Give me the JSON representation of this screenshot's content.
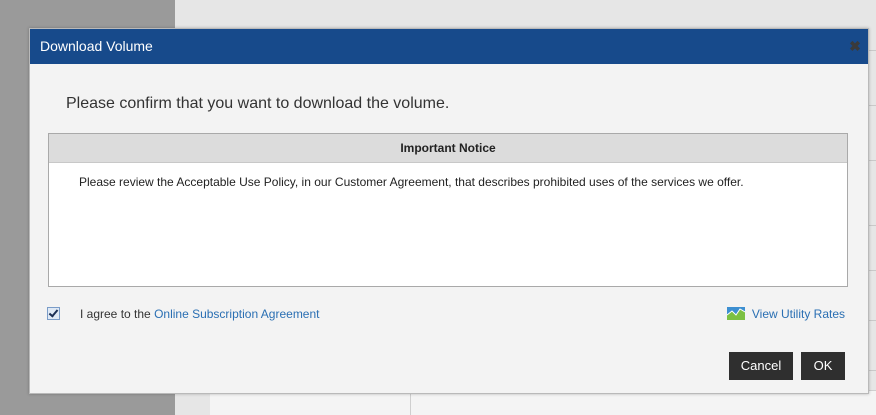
{
  "dialog": {
    "title": "Download Volume",
    "close_icon": "close-icon",
    "prompt": "Please confirm that you want to download the volume.",
    "notice": {
      "header": "Important Notice",
      "body": "Please review the Acceptable Use Policy, in our Customer Agreement, that describes prohibited uses of the services we offer."
    },
    "agreement": {
      "checked": true,
      "prefix": "I agree to the",
      "link_text": "Online Subscription Agreement"
    },
    "utility_rates": {
      "icon": "chart-icon",
      "label": "View Utility Rates"
    },
    "buttons": {
      "cancel": "Cancel",
      "ok": "OK"
    }
  },
  "colors": {
    "titlebar": "#174a8b",
    "link": "#2a6fb3",
    "button": "#2f2f2f"
  }
}
